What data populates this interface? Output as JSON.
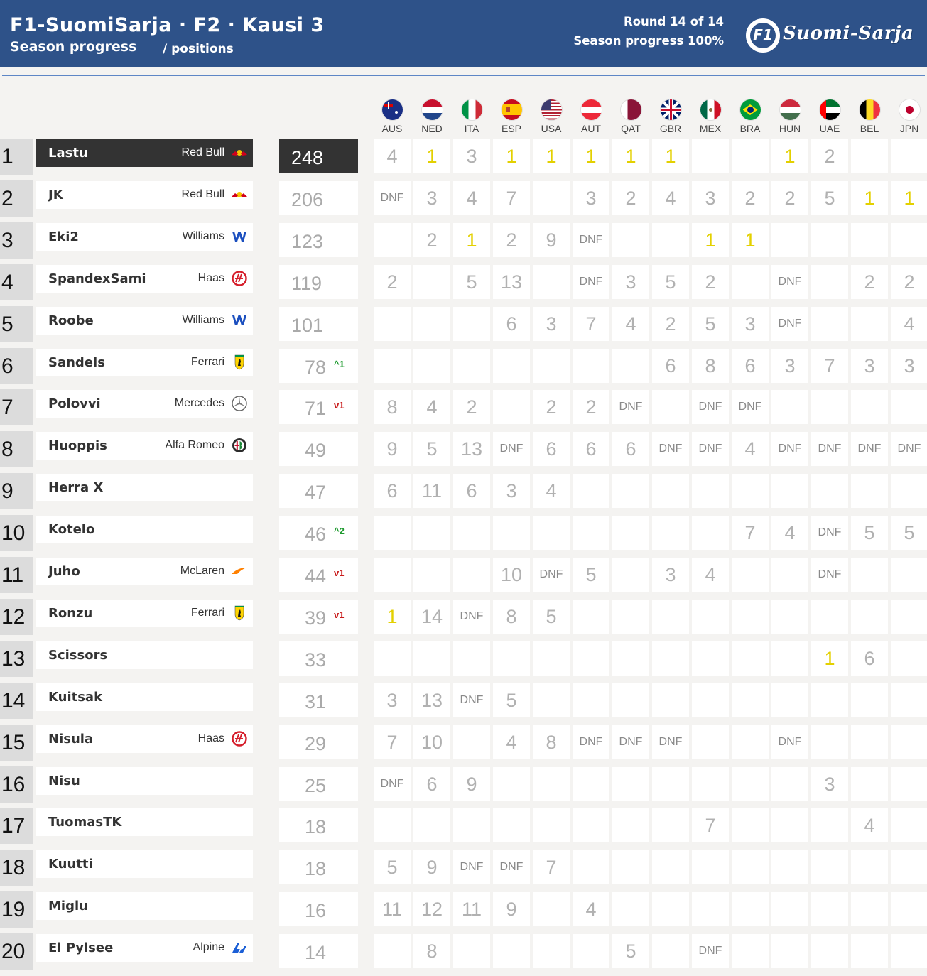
{
  "header": {
    "title": "F1-SuomiSarja · F2 · Kausi 3",
    "subtitle": "Season progress",
    "subtitle2": "/ positions",
    "round": "Round 14 of 14",
    "progress": "Season progress 100%",
    "logo_mark": "F1",
    "logo_text": "Suomi-Sarja"
  },
  "races": [
    "AUS",
    "NED",
    "ITA",
    "ESP",
    "USA",
    "AUT",
    "QAT",
    "GBR",
    "MEX",
    "BRA",
    "HUN",
    "UAE",
    "BEL",
    "JPN"
  ],
  "rows": [
    {
      "pos": "1",
      "name": "Lastu",
      "team": "Red Bull",
      "icon": "redbull",
      "points": "248",
      "delta": "",
      "dir": "",
      "results": [
        "4",
        "1",
        "3",
        "1",
        "1",
        "1",
        "1",
        "1",
        "",
        "",
        "1",
        "2",
        "",
        ""
      ]
    },
    {
      "pos": "2",
      "name": "JK",
      "team": "Red Bull",
      "icon": "redbull",
      "points": "206",
      "delta": "",
      "dir": "",
      "results": [
        "DNF",
        "3",
        "4",
        "7",
        "",
        "3",
        "2",
        "4",
        "3",
        "2",
        "2",
        "5",
        "1",
        "1"
      ]
    },
    {
      "pos": "3",
      "name": "Eki2",
      "team": "Williams",
      "icon": "williams",
      "points": "123",
      "delta": "",
      "dir": "",
      "results": [
        "",
        "2",
        "1",
        "2",
        "9",
        "DNF",
        "",
        "",
        "1",
        "1",
        "",
        "",
        "",
        ""
      ]
    },
    {
      "pos": "4",
      "name": "SpandexSami",
      "team": "Haas",
      "icon": "haas",
      "points": "119",
      "delta": "",
      "dir": "",
      "results": [
        "2",
        "",
        "5",
        "13",
        "",
        "DNF",
        "3",
        "5",
        "2",
        "",
        "DNF",
        "",
        "2",
        "2"
      ]
    },
    {
      "pos": "5",
      "name": "Roobe",
      "team": "Williams",
      "icon": "williams",
      "points": "101",
      "delta": "",
      "dir": "",
      "results": [
        "",
        "",
        "",
        "6",
        "3",
        "7",
        "4",
        "2",
        "5",
        "3",
        "DNF",
        "",
        "",
        "4"
      ]
    },
    {
      "pos": "6",
      "name": "Sandels",
      "team": "Ferrari",
      "icon": "ferrari",
      "points": "78",
      "delta": "^1",
      "dir": "up",
      "results": [
        "",
        "",
        "",
        "",
        "",
        "",
        "",
        "6",
        "8",
        "6",
        "3",
        "7",
        "3",
        "3"
      ]
    },
    {
      "pos": "7",
      "name": "Polovvi",
      "team": "Mercedes",
      "icon": "mercedes",
      "points": "71",
      "delta": "v1",
      "dir": "down",
      "results": [
        "8",
        "4",
        "2",
        "",
        "2",
        "2",
        "DNF",
        "",
        "DNF",
        "DNF",
        "",
        "",
        "",
        ""
      ]
    },
    {
      "pos": "8",
      "name": "Huoppis",
      "team": "Alfa Romeo",
      "icon": "alfaromeo",
      "points": "49",
      "delta": "",
      "dir": "",
      "results": [
        "9",
        "5",
        "13",
        "DNF",
        "6",
        "6",
        "6",
        "DNF",
        "DNF",
        "4",
        "DNF",
        "DNF",
        "DNF",
        "DNF"
      ]
    },
    {
      "pos": "9",
      "name": "Herra X",
      "team": "",
      "icon": "",
      "points": "47",
      "delta": "",
      "dir": "",
      "results": [
        "6",
        "11",
        "6",
        "3",
        "4",
        "",
        "",
        "",
        "",
        "",
        "",
        "",
        "",
        ""
      ]
    },
    {
      "pos": "10",
      "name": "Kotelo",
      "team": "",
      "icon": "",
      "points": "46",
      "delta": "^2",
      "dir": "up",
      "results": [
        "",
        "",
        "",
        "",
        "",
        "",
        "",
        "",
        "",
        "7",
        "4",
        "DNF",
        "5",
        "5"
      ]
    },
    {
      "pos": "11",
      "name": "Juho",
      "team": "McLaren",
      "icon": "mclaren",
      "points": "44",
      "delta": "v1",
      "dir": "down",
      "results": [
        "",
        "",
        "",
        "10",
        "DNF",
        "5",
        "",
        "3",
        "4",
        "",
        "",
        "DNF",
        "",
        ""
      ]
    },
    {
      "pos": "12",
      "name": "Ronzu",
      "team": "Ferrari",
      "icon": "ferrari",
      "points": "39",
      "delta": "v1",
      "dir": "down",
      "results": [
        "1",
        "14",
        "DNF",
        "8",
        "5",
        "",
        "",
        "",
        "",
        "",
        "",
        "",
        "",
        ""
      ]
    },
    {
      "pos": "13",
      "name": "Scissors",
      "team": "",
      "icon": "",
      "points": "33",
      "delta": "",
      "dir": "",
      "results": [
        "",
        "",
        "",
        "",
        "",
        "",
        "",
        "",
        "",
        "",
        "",
        "1",
        "6",
        ""
      ]
    },
    {
      "pos": "14",
      "name": "Kuitsak",
      "team": "",
      "icon": "",
      "points": "31",
      "delta": "",
      "dir": "",
      "results": [
        "3",
        "13",
        "DNF",
        "5",
        "",
        "",
        "",
        "",
        "",
        "",
        "",
        "",
        "",
        ""
      ]
    },
    {
      "pos": "15",
      "name": "Nisula",
      "team": "Haas",
      "icon": "haas",
      "points": "29",
      "delta": "",
      "dir": "",
      "results": [
        "7",
        "10",
        "",
        "4",
        "8",
        "DNF",
        "DNF",
        "DNF",
        "",
        "",
        "DNF",
        "",
        "",
        ""
      ]
    },
    {
      "pos": "16",
      "name": "Nisu",
      "team": "",
      "icon": "",
      "points": "25",
      "delta": "",
      "dir": "",
      "results": [
        "DNF",
        "6",
        "9",
        "",
        "",
        "",
        "",
        "",
        "",
        "",
        "",
        "3",
        "",
        ""
      ]
    },
    {
      "pos": "17",
      "name": "TuomasTK",
      "team": "",
      "icon": "",
      "points": "18",
      "delta": "",
      "dir": "",
      "results": [
        "",
        "",
        "",
        "",
        "",
        "",
        "",
        "",
        "7",
        "",
        "",
        "",
        "4",
        ""
      ]
    },
    {
      "pos": "18",
      "name": "Kuutti",
      "team": "",
      "icon": "",
      "points": "18",
      "delta": "",
      "dir": "",
      "results": [
        "5",
        "9",
        "DNF",
        "DNF",
        "7",
        "",
        "",
        "",
        "",
        "",
        "",
        "",
        "",
        ""
      ]
    },
    {
      "pos": "19",
      "name": "Miglu",
      "team": "",
      "icon": "",
      "points": "16",
      "delta": "",
      "dir": "",
      "results": [
        "11",
        "12",
        "11",
        "9",
        "",
        "4",
        "",
        "",
        "",
        "",
        "",
        "",
        "",
        ""
      ]
    },
    {
      "pos": "20",
      "name": "El Pylsee",
      "team": "Alpine",
      "icon": "alpine",
      "points": "14",
      "delta": "",
      "dir": "",
      "results": [
        "",
        "8",
        "",
        "",
        "",
        "",
        "5",
        "",
        "DNF",
        "",
        "",
        "",
        "",
        ""
      ]
    }
  ],
  "colors": {
    "header_bg": "#2e5289",
    "win_yellow": "#e3d000",
    "up_green": "#1d9a2e",
    "down_red": "#c81a1a",
    "leader_bg": "#333333"
  }
}
